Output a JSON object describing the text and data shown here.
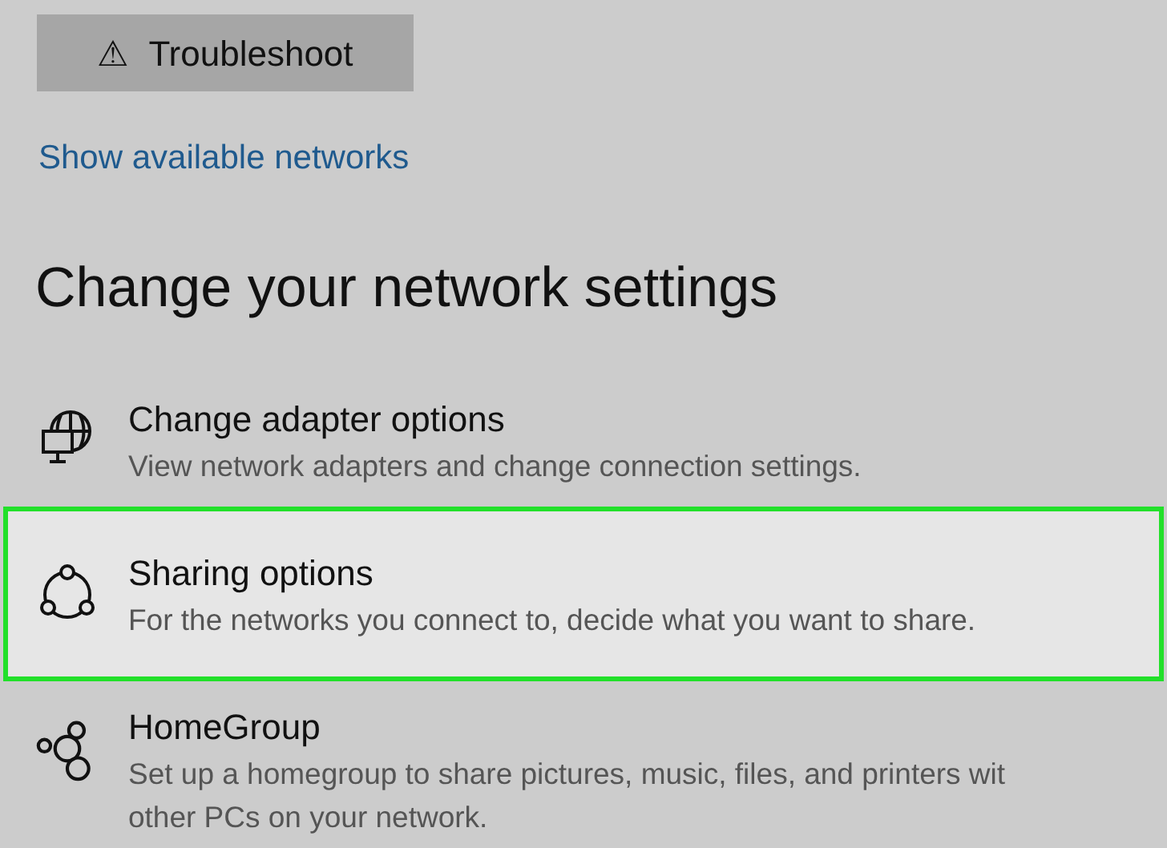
{
  "troubleshoot_button": {
    "icon": "⚠",
    "label": "Troubleshoot"
  },
  "link": "Show available networks",
  "heading": "Change your network settings",
  "items": [
    {
      "kind": "adapter",
      "title": "Change adapter options",
      "lines": [
        "View network adapters and change connection settings."
      ],
      "highlighted": false
    },
    {
      "kind": "sharing",
      "title": "Sharing options",
      "lines": [
        "For the networks you connect to, decide what you want to share."
      ],
      "highlighted": true
    },
    {
      "kind": "homegroup",
      "title": "HomeGroup",
      "lines": [
        "Set up a homegroup to share pictures, music, files, and printers wit",
        "other PCs on your network."
      ],
      "highlighted": false
    }
  ]
}
